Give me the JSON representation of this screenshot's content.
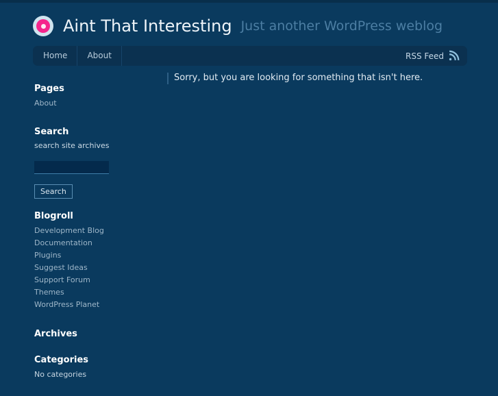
{
  "site": {
    "title": "Aint That Interesting",
    "tagline": "Just another WordPress weblog",
    "logo_icon": "target-circle-icon"
  },
  "nav": {
    "items": [
      {
        "label": "Home"
      },
      {
        "label": "About"
      }
    ],
    "rss": {
      "label": "RSS Feed",
      "icon": "rss-feed-icon"
    }
  },
  "main": {
    "not_found_message": "Sorry, but you are looking for something that isn't here."
  },
  "sidebar": {
    "pages": {
      "title": "Pages",
      "items": [
        {
          "label": "About"
        }
      ]
    },
    "search": {
      "title": "Search",
      "label": "search site archives",
      "input_value": "",
      "input_placeholder": "",
      "button_label": "Search"
    },
    "blogroll": {
      "title": "Blogroll",
      "items": [
        {
          "label": "Development Blog"
        },
        {
          "label": "Documentation"
        },
        {
          "label": "Plugins"
        },
        {
          "label": "Suggest Ideas"
        },
        {
          "label": "Support Forum"
        },
        {
          "label": "Themes"
        },
        {
          "label": "WordPress Planet"
        }
      ]
    },
    "archives": {
      "title": "Archives",
      "items": []
    },
    "categories": {
      "title": "Categories",
      "empty_text": "No categories"
    }
  },
  "colors": {
    "page_background": "#0a3a5e",
    "top_strip": "#082e4b",
    "navbar_background": "#0b3150",
    "accent_pink": "#f5258c",
    "logo_ring": "#cfe4ef",
    "tagline": "#4c7ea3",
    "link": "#9fb7c9",
    "heading": "#ffffff",
    "rss_icon": "#8fc0dd"
  }
}
